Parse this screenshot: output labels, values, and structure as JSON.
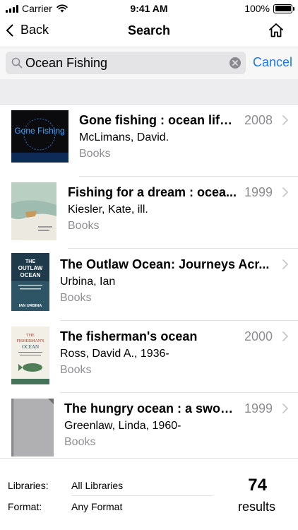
{
  "status": {
    "carrier": "Carrier",
    "time": "9:41 AM",
    "battery": "100%"
  },
  "nav": {
    "back_label": "Back",
    "title": "Search"
  },
  "search": {
    "value": "Ocean Fishing",
    "cancel_label": "Cancel"
  },
  "results": [
    {
      "title": "Gone fishing : ocean life...",
      "author": "McLimans, David.",
      "type": "Books",
      "year": "2008",
      "cover_text": "Gone Fishing"
    },
    {
      "title": "Fishing for a dream : ocea...",
      "author": "Kiesler, Kate, ill.",
      "type": "Books",
      "year": "1999"
    },
    {
      "title": "The Outlaw Ocean: Journeys Acr...",
      "author": "Urbina, Ian",
      "type": "Books",
      "year": "",
      "cover_text": "THE OUTLAW OCEAN",
      "cover_sub": "JOURNEYS ACROSS THE LAST UNTAMED FRONTIER",
      "cover_author": "IAN URBINA"
    },
    {
      "title": "The fisherman's ocean",
      "author": "Ross, David A., 1936-",
      "type": "Books",
      "year": "2000",
      "cover_text": "THE FISHERMAN'S OCEAN"
    },
    {
      "title": "The hungry ocean : a swor...",
      "author": "Greenlaw, Linda, 1960-",
      "type": "Books",
      "year": "1999"
    }
  ],
  "footer": {
    "libraries_label": "Libraries:",
    "libraries_value": "All Libraries",
    "format_label": "Format:",
    "format_value": "Any Format",
    "count": "74",
    "count_label": "results"
  },
  "colors": {
    "accent": "#1a7ae6",
    "secondary_text": "#8e8e93"
  }
}
